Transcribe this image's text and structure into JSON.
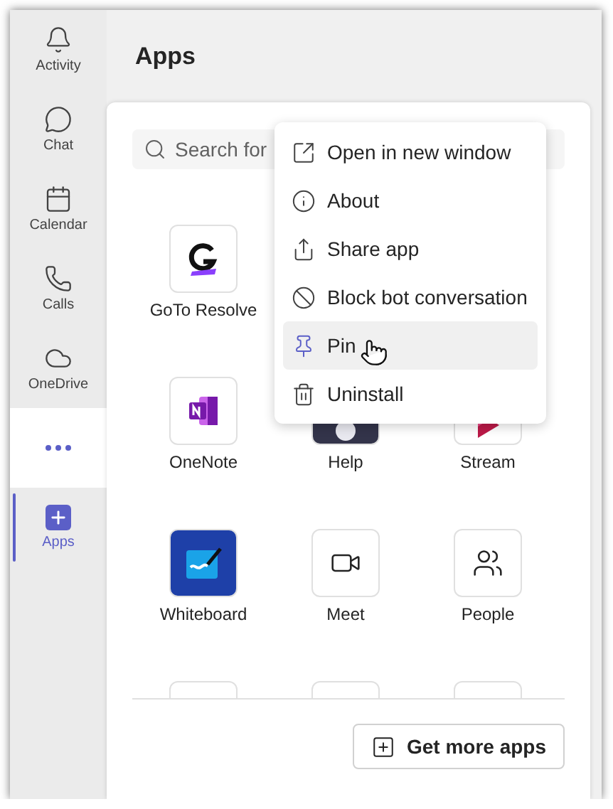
{
  "sidebar": {
    "items": [
      {
        "label": "Activity",
        "kind": "bell",
        "selected": false
      },
      {
        "label": "Chat",
        "kind": "chat",
        "selected": false
      },
      {
        "label": "Calendar",
        "kind": "calendar",
        "selected": false
      },
      {
        "label": "Calls",
        "kind": "phone",
        "selected": false
      },
      {
        "label": "OneDrive",
        "kind": "cloud",
        "selected": false
      },
      {
        "kind": "more",
        "selected": false
      },
      {
        "label": "Apps",
        "kind": "apps",
        "selected": true
      }
    ]
  },
  "header": {
    "title": "Apps"
  },
  "search": {
    "placeholder": "Search for"
  },
  "app_rows": [
    {
      "tiles": [
        {
          "kind": "goto",
          "label": "GoTo Resolve"
        }
      ]
    },
    {
      "tiles": [
        {
          "kind": "onenote",
          "label": "OneNote"
        },
        {
          "kind": "help",
          "label": "Help"
        },
        {
          "kind": "stream",
          "label": "Stream"
        }
      ]
    },
    {
      "tiles": [
        {
          "kind": "whiteboard",
          "label": "Whiteboard"
        },
        {
          "kind": "meet",
          "label": "Meet"
        },
        {
          "kind": "people",
          "label": "People"
        }
      ]
    },
    {
      "tiles": [
        {
          "kind": "blank"
        },
        {
          "kind": "blank"
        },
        {
          "kind": "blank"
        }
      ]
    }
  ],
  "context_menu": {
    "items": [
      {
        "kind": "open",
        "label": "Open in new window",
        "selected": false
      },
      {
        "kind": "about",
        "label": "About",
        "selected": false
      },
      {
        "kind": "share",
        "label": "Share app",
        "selected": false
      },
      {
        "kind": "block",
        "label": "Block bot conversation",
        "selected": false
      },
      {
        "kind": "pin",
        "label": "Pin",
        "selected": true
      },
      {
        "kind": "uninstall",
        "label": "Uninstall",
        "selected": false
      }
    ]
  },
  "get_more_button": {
    "label": "Get more apps"
  }
}
